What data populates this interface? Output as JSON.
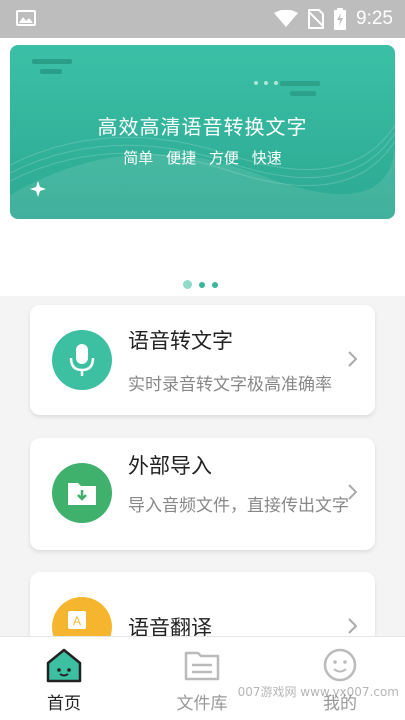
{
  "status_bar": {
    "time": "9:25",
    "icons": [
      "gallery-icon",
      "wifi-icon",
      "no-sim-icon",
      "battery-charging-icon"
    ]
  },
  "banner": {
    "title": "高效高清语音转换文字",
    "tags": [
      "简单",
      "便捷",
      "方便",
      "快速"
    ]
  },
  "carousel": {
    "page_count": 3,
    "active_index": 0
  },
  "features": [
    {
      "title": "语音转文字",
      "description": "实时录音转文字极高准确率",
      "icon": "microphone-icon",
      "color": "#3dbfa2"
    },
    {
      "title": "外部导入",
      "description": "导入音频文件，直接传出文字",
      "icon": "folder-import-icon",
      "color": "#3fb16c"
    },
    {
      "title": "语音翻译",
      "description": "",
      "icon": "translate-icon",
      "color": "#f5b52e"
    }
  ],
  "tabs": [
    {
      "label": "首页",
      "icon": "home-icon",
      "active": true
    },
    {
      "label": "文件库",
      "icon": "file-library-icon",
      "active": false
    },
    {
      "label": "我的",
      "icon": "smiley-icon",
      "active": false
    }
  ],
  "watermark": "007游戏网 www.yx007.com",
  "colors": {
    "accent": "#3bb69c",
    "status_bar": "#bdbdbd",
    "active_tab": "#222222",
    "inactive_tab": "#bbbbbb"
  }
}
